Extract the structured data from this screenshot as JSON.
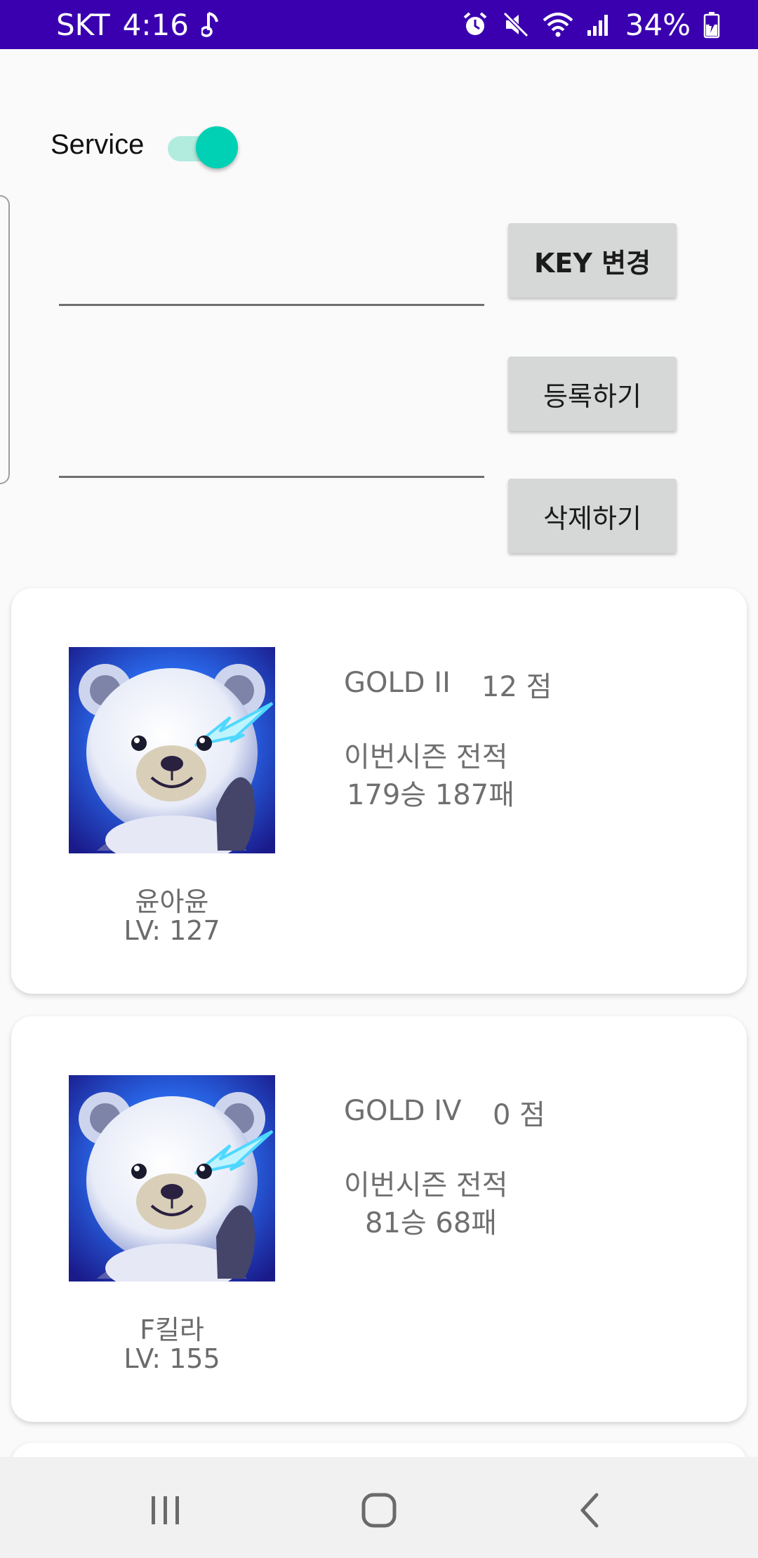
{
  "status_bar": {
    "carrier": "SKT",
    "time": "4:16",
    "battery_percent": "34%",
    "background_color": "#3a00b0",
    "icons_left": [
      "music-note-icon"
    ],
    "icons_right": [
      "alarm-icon",
      "mute-icon",
      "wifi-icon",
      "signal-icon",
      "battery-charging-icon"
    ]
  },
  "service": {
    "label": "Service",
    "enabled": true,
    "accent_color": "#00d1b4"
  },
  "inputs": {
    "key_value": "",
    "register_value": ""
  },
  "buttons": {
    "key_change": "KEY 변경",
    "register": "등록하기",
    "delete": "삭제하기"
  },
  "cards": [
    {
      "tier": "GOLD II",
      "points": "12 점",
      "season_label": "이번시즌 전적",
      "record": "179승 187패",
      "name": "윤아윤",
      "level": "LV: 127",
      "icon": "polar-bear-avatar-icon"
    },
    {
      "tier": "GOLD IV",
      "points": "0 점",
      "season_label": "이번시즌 전적",
      "record": "81승 68패",
      "name": "F킬라",
      "level": "LV: 155",
      "icon": "polar-bear-avatar-icon"
    }
  ],
  "nav_bar": {
    "icons": [
      "recent-apps-icon",
      "home-icon",
      "back-icon"
    ]
  }
}
